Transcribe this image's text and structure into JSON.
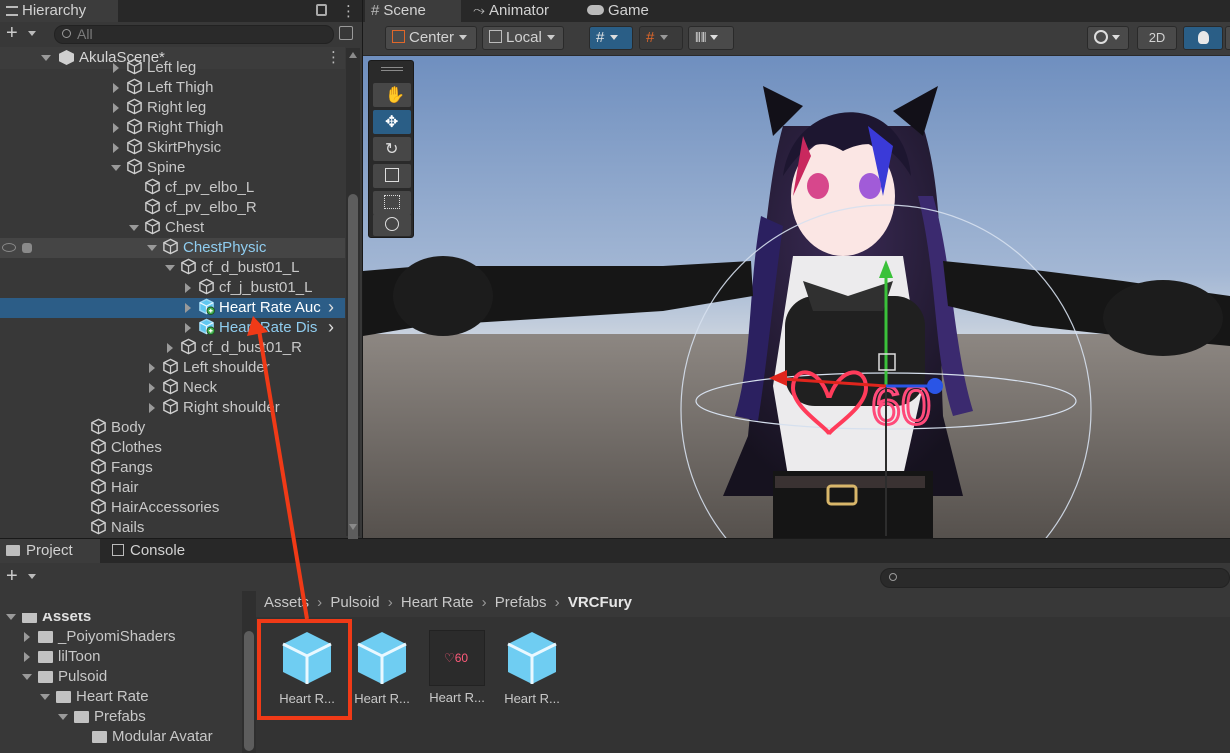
{
  "hierarchy": {
    "tab_label": "Hierarchy",
    "search_placeholder": "All",
    "scene_name": "AkulaScene*",
    "items": [
      {
        "label": "Left leg",
        "indent": 108,
        "arrow": "right"
      },
      {
        "label": "Left Thigh",
        "indent": 108,
        "arrow": "right"
      },
      {
        "label": "Right leg",
        "indent": 108,
        "arrow": "right"
      },
      {
        "label": "Right Thigh",
        "indent": 108,
        "arrow": "right"
      },
      {
        "label": "SkirtPhysic",
        "indent": 108,
        "arrow": "right"
      },
      {
        "label": "Spine",
        "indent": 108,
        "arrow": "down"
      },
      {
        "label": "cf_pv_elbo_L",
        "indent": 126,
        "arrow": "none"
      },
      {
        "label": "cf_pv_elbo_R",
        "indent": 126,
        "arrow": "none"
      },
      {
        "label": "Chest",
        "indent": 126,
        "arrow": "down"
      },
      {
        "label": "ChestPhysic",
        "indent": 144,
        "arrow": "down"
      },
      {
        "label": "cf_d_bust01_L",
        "indent": 162,
        "arrow": "down"
      },
      {
        "label": "cf_j_bust01_L",
        "indent": 180,
        "arrow": "right"
      },
      {
        "label": "Heart Rate Auc",
        "indent": 180,
        "arrow": "right",
        "state": "selected"
      },
      {
        "label": "Heart Rate Dis",
        "indent": 180,
        "arrow": "right",
        "state": "prefab"
      },
      {
        "label": "cf_d_bust01_R",
        "indent": 162,
        "arrow": "right"
      },
      {
        "label": "Left shoulder",
        "indent": 144,
        "arrow": "right"
      },
      {
        "label": "Neck",
        "indent": 144,
        "arrow": "right"
      },
      {
        "label": "Right shoulder",
        "indent": 144,
        "arrow": "right"
      },
      {
        "label": "Body",
        "indent": 72,
        "arrow": "none"
      },
      {
        "label": "Clothes",
        "indent": 72,
        "arrow": "none"
      },
      {
        "label": "Fangs",
        "indent": 72,
        "arrow": "none"
      },
      {
        "label": "Hair",
        "indent": 72,
        "arrow": "none"
      },
      {
        "label": "HairAccessories",
        "indent": 72,
        "arrow": "none"
      },
      {
        "label": "Nails",
        "indent": 72,
        "arrow": "none"
      }
    ]
  },
  "scene": {
    "tabs": [
      "Scene",
      "Animator",
      "Game"
    ],
    "pivot_label": "Center",
    "space_label": "Local",
    "mode_2d": "2D",
    "heart_value": "60"
  },
  "project": {
    "tabs": [
      "Project",
      "Console"
    ],
    "breadcrumb": [
      "Assets",
      "Pulsoid",
      "Heart Rate",
      "Prefabs",
      "VRCFury"
    ],
    "tree": [
      {
        "label": "Assets",
        "indent": 8,
        "arrow": "down",
        "bold": true
      },
      {
        "label": "_PoiyomiShaders",
        "indent": 24,
        "arrow": "right"
      },
      {
        "label": "lilToon",
        "indent": 24,
        "arrow": "right"
      },
      {
        "label": "Pulsoid",
        "indent": 24,
        "arrow": "down"
      },
      {
        "label": "Heart Rate",
        "indent": 42,
        "arrow": "down"
      },
      {
        "label": "Prefabs",
        "indent": 60,
        "arrow": "down"
      },
      {
        "label": "Modular Avatar",
        "indent": 78,
        "arrow": "none"
      }
    ],
    "assets": [
      {
        "label": "Heart R...",
        "kind": "cube"
      },
      {
        "label": "Heart R...",
        "kind": "cube"
      },
      {
        "label": "Heart R...",
        "kind": "thumb"
      },
      {
        "label": "Heart R...",
        "kind": "cube"
      }
    ]
  },
  "colors": {
    "selection": "#2c5d87",
    "accent_blue": "#56b9e8",
    "annotation_red": "#f03a17"
  }
}
